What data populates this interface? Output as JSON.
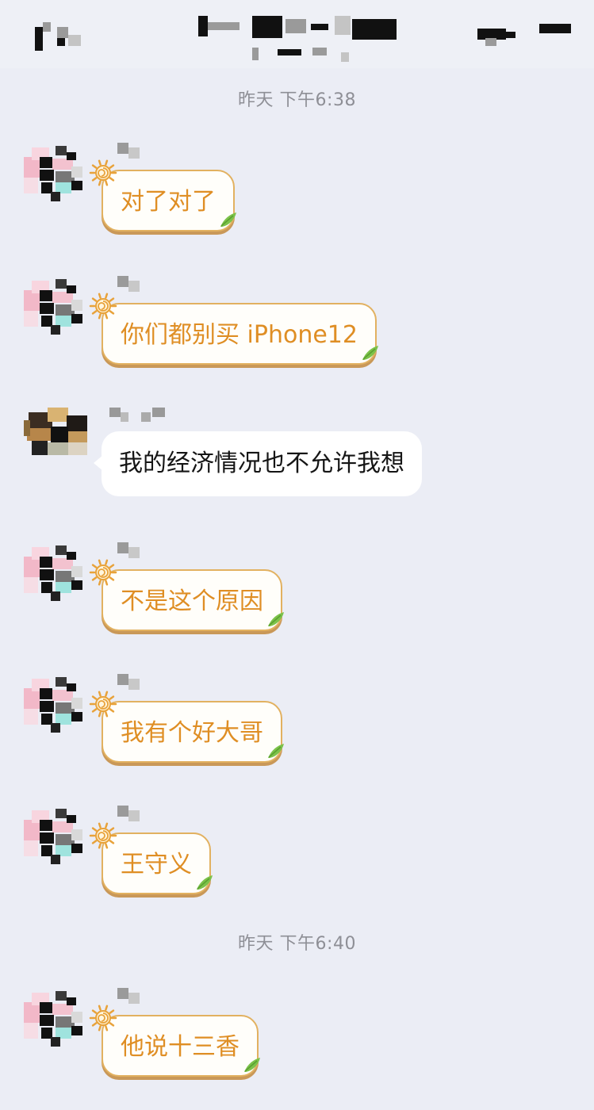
{
  "header": {
    "title": "",
    "subtitle": ""
  },
  "timestamps": [
    "昨天 下午6:38",
    "昨天 下午6:40"
  ],
  "messages": [
    {
      "text": "对了对了",
      "style": "theme",
      "sender": "self-blurred"
    },
    {
      "text": "你们都别买 iPhone12",
      "style": "theme",
      "sender": "self-blurred"
    },
    {
      "text": "我的经济情况也不允许我想",
      "style": "plain",
      "sender": "other-blurred"
    },
    {
      "text": "不是这个原因",
      "style": "theme",
      "sender": "self-blurred"
    },
    {
      "text": "我有个好大哥",
      "style": "theme",
      "sender": "self-blurred"
    },
    {
      "text": "王守义",
      "style": "theme",
      "sender": "self-blurred"
    },
    {
      "text": "他说十三香",
      "style": "theme",
      "sender": "self-blurred"
    }
  ],
  "colors": {
    "background": "#ebedf5",
    "theme_bubble_text": "#df8e24",
    "theme_bubble_border": "#e2b160",
    "plain_bubble_text": "#151515",
    "timestamp_text": "#8e8f96"
  },
  "icons": [
    "back-icon",
    "more-icon",
    "sun-sticker-icon",
    "leaf-icon"
  ]
}
